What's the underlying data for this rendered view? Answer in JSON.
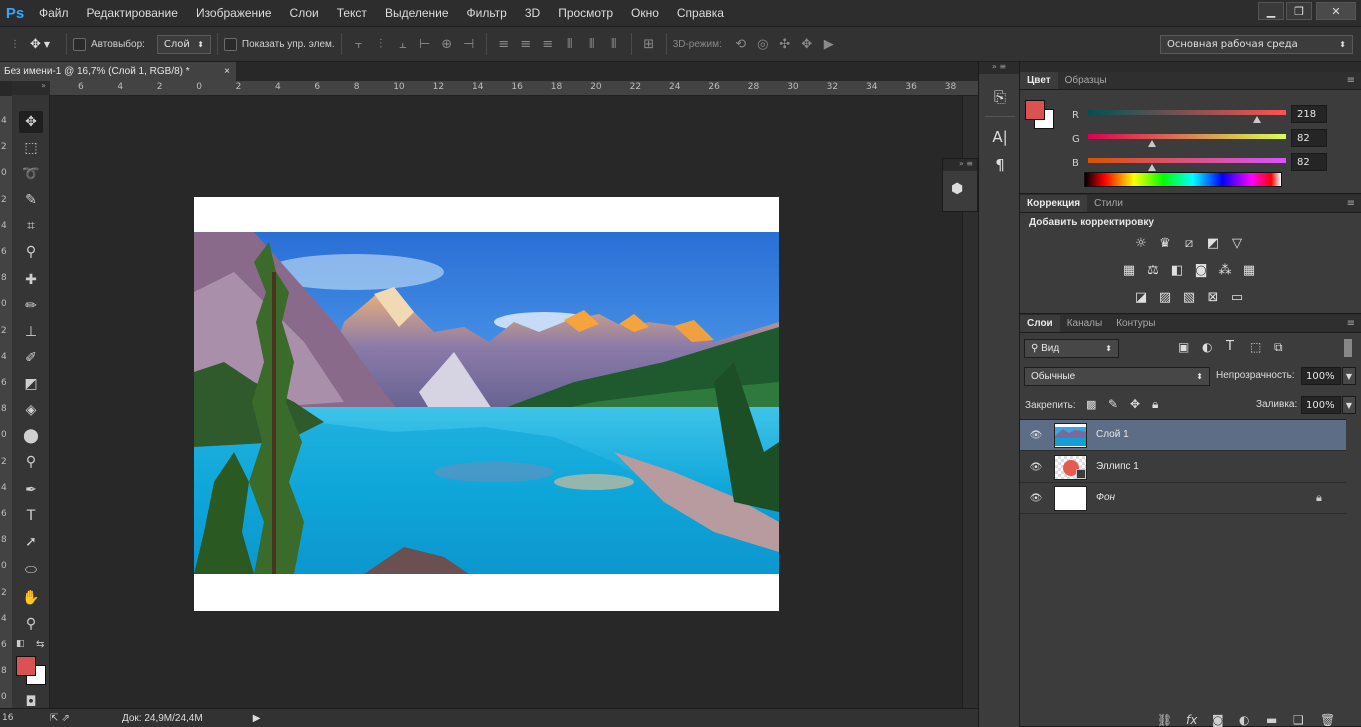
{
  "app": {
    "logo": "Ps",
    "menu": [
      "Файл",
      "Редактирование",
      "Изображение",
      "Слои",
      "Текст",
      "Выделение",
      "Фильтр",
      "3D",
      "Просмотр",
      "Окно",
      "Справка"
    ]
  },
  "options_bar": {
    "autoselect_label": "Автовыбор:",
    "autoselect_value": "Слой",
    "show_controls_label": "Показать упр. элем.",
    "mode_3d_label": "3D-режим:",
    "workspace": "Основная рабочая среда"
  },
  "document": {
    "tab_title": "Без имени-1 @ 16,7% (Слой 1, RGB/8) *",
    "close_glyph": "×",
    "ruler_h": [
      "6",
      "4",
      "2",
      "0",
      "2",
      "4",
      "6",
      "8",
      "10",
      "12",
      "14",
      "16",
      "18",
      "20",
      "22",
      "24",
      "26",
      "28",
      "30",
      "32",
      "34",
      "36",
      "38"
    ],
    "ruler_v": [
      "4",
      "2",
      "0",
      "2",
      "4",
      "6",
      "8",
      "0",
      "2",
      "4",
      "6",
      "8",
      "0",
      "2",
      "4",
      "6",
      "8",
      "0",
      "2",
      "4",
      "6",
      "8",
      "0",
      "2",
      "4"
    ],
    "zoom": "16",
    "doc_size": "Док: 24,9M/24,4M"
  },
  "color_panel": {
    "tabs": [
      "Цвет",
      "Образцы"
    ],
    "foreground": "#da5252",
    "background": "#ffffff",
    "r_label": "R",
    "r_value": "218",
    "r_fraction": 0.855,
    "g_label": "G",
    "g_value": "82",
    "g_fraction": 0.322,
    "b_label": "B",
    "b_value": "82",
    "b_fraction": 0.322
  },
  "adjustments_panel": {
    "tabs": [
      "Коррекция",
      "Стили"
    ],
    "heading": "Добавить корректировку"
  },
  "layers_panel": {
    "tabs": [
      "Слои",
      "Каналы",
      "Контуры"
    ],
    "filter_kind": "Вид",
    "blend_mode": "Обычные",
    "opacity_label": "Непрозрачность:",
    "opacity_value": "100%",
    "lock_label": "Закрепить:",
    "fill_label": "Заливка:",
    "fill_value": "100%",
    "layers": [
      {
        "name": "Слой 1",
        "selected": true
      },
      {
        "name": "Эллипс 1",
        "selected": false
      },
      {
        "name": "Фон",
        "selected": false,
        "locked": true
      }
    ]
  },
  "icons": {
    "eye": "eye-icon",
    "lock": "lock-icon",
    "link": "link-icon",
    "fx": "fx"
  }
}
